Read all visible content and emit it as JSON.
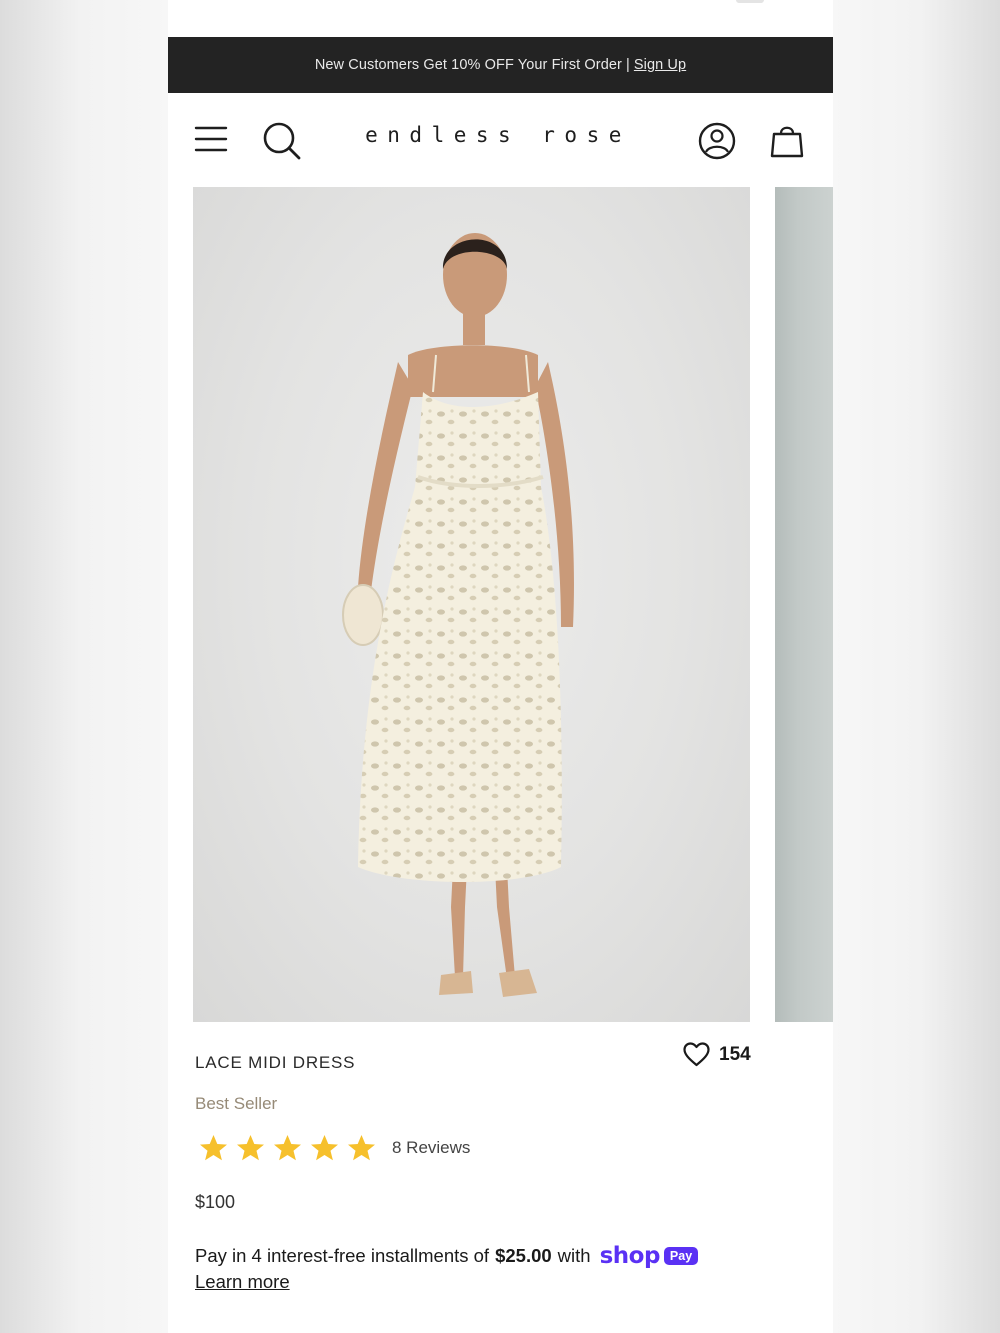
{
  "announcement": {
    "text": "New Customers Get 10% OFF Your First Order",
    "separator": "|",
    "link_label": "Sign Up"
  },
  "header": {
    "brand": "endless rose",
    "icons": [
      "menu-icon",
      "search-icon",
      "account-icon",
      "cart-icon"
    ]
  },
  "product": {
    "title": "LACE MIDI DRESS",
    "badge": "Best Seller",
    "wishlist_count": "154",
    "rating": 5,
    "rating_max": 5,
    "reviews_label": "8 Reviews",
    "price": "$100"
  },
  "installments": {
    "prefix": "Pay in 4 interest-free installments of",
    "amount": "$25.00",
    "suffix": "with",
    "provider_logo": "shop",
    "provider_pill": "Pay",
    "learn_more": "Learn more"
  },
  "colors": {
    "announcement_bg": "#232323",
    "star": "#f6c02c",
    "badge": "#968a77",
    "shop_pay": "#5a31f4"
  }
}
